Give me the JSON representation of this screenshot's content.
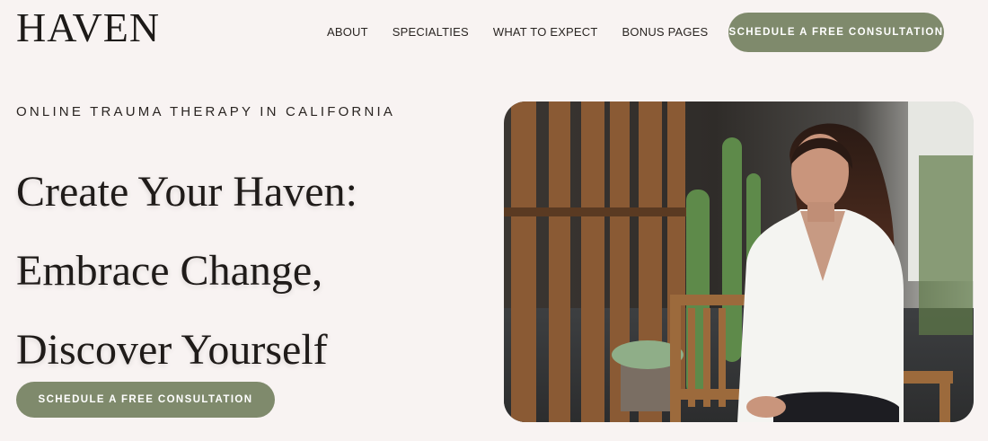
{
  "header": {
    "logo": "HAVEN",
    "nav": [
      "ABOUT",
      "SPECIALTIES",
      "WHAT TO EXPECT",
      "BONUS PAGES"
    ],
    "cta_label": "SCHEDULE A FREE CONSULTATION"
  },
  "hero": {
    "eyebrow": "ONLINE TRAUMA THERAPY IN CALIFORNIA",
    "headline_lines": [
      "Create Your Haven:",
      "Embrace Change,",
      "Discover Yourself"
    ],
    "cta_label": "SCHEDULE A FREE CONSULTATION"
  },
  "colors": {
    "background": "#f8f3f2",
    "accent": "#7f8a6c",
    "text": "#1f1b19"
  }
}
